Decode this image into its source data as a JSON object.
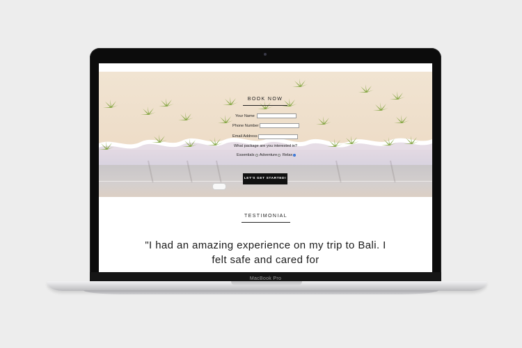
{
  "device": {
    "label": "MacBook Pro"
  },
  "book": {
    "title": "BOOK NOW",
    "fields": {
      "name_label": "Your Name",
      "phone_label": "Phone Number",
      "email_label": "Email Address",
      "package_question": "What package are you interested in?"
    },
    "packages": [
      "Essentials",
      "Adventure",
      "Relax"
    ],
    "selected_package": "Relax",
    "cta_label": "LET'S GET STARTED!"
  },
  "testimonial": {
    "title": "TESTIMONIAL",
    "quote": "\"I had an amazing experience on my trip to Bali. I felt safe and cared for"
  },
  "colors": {
    "background": "#ededed",
    "sand": "#f1e4d2",
    "sea": "#d9d3e0",
    "road": "#c9c6c8",
    "palm": "#7fa03a",
    "button": "#111111"
  }
}
